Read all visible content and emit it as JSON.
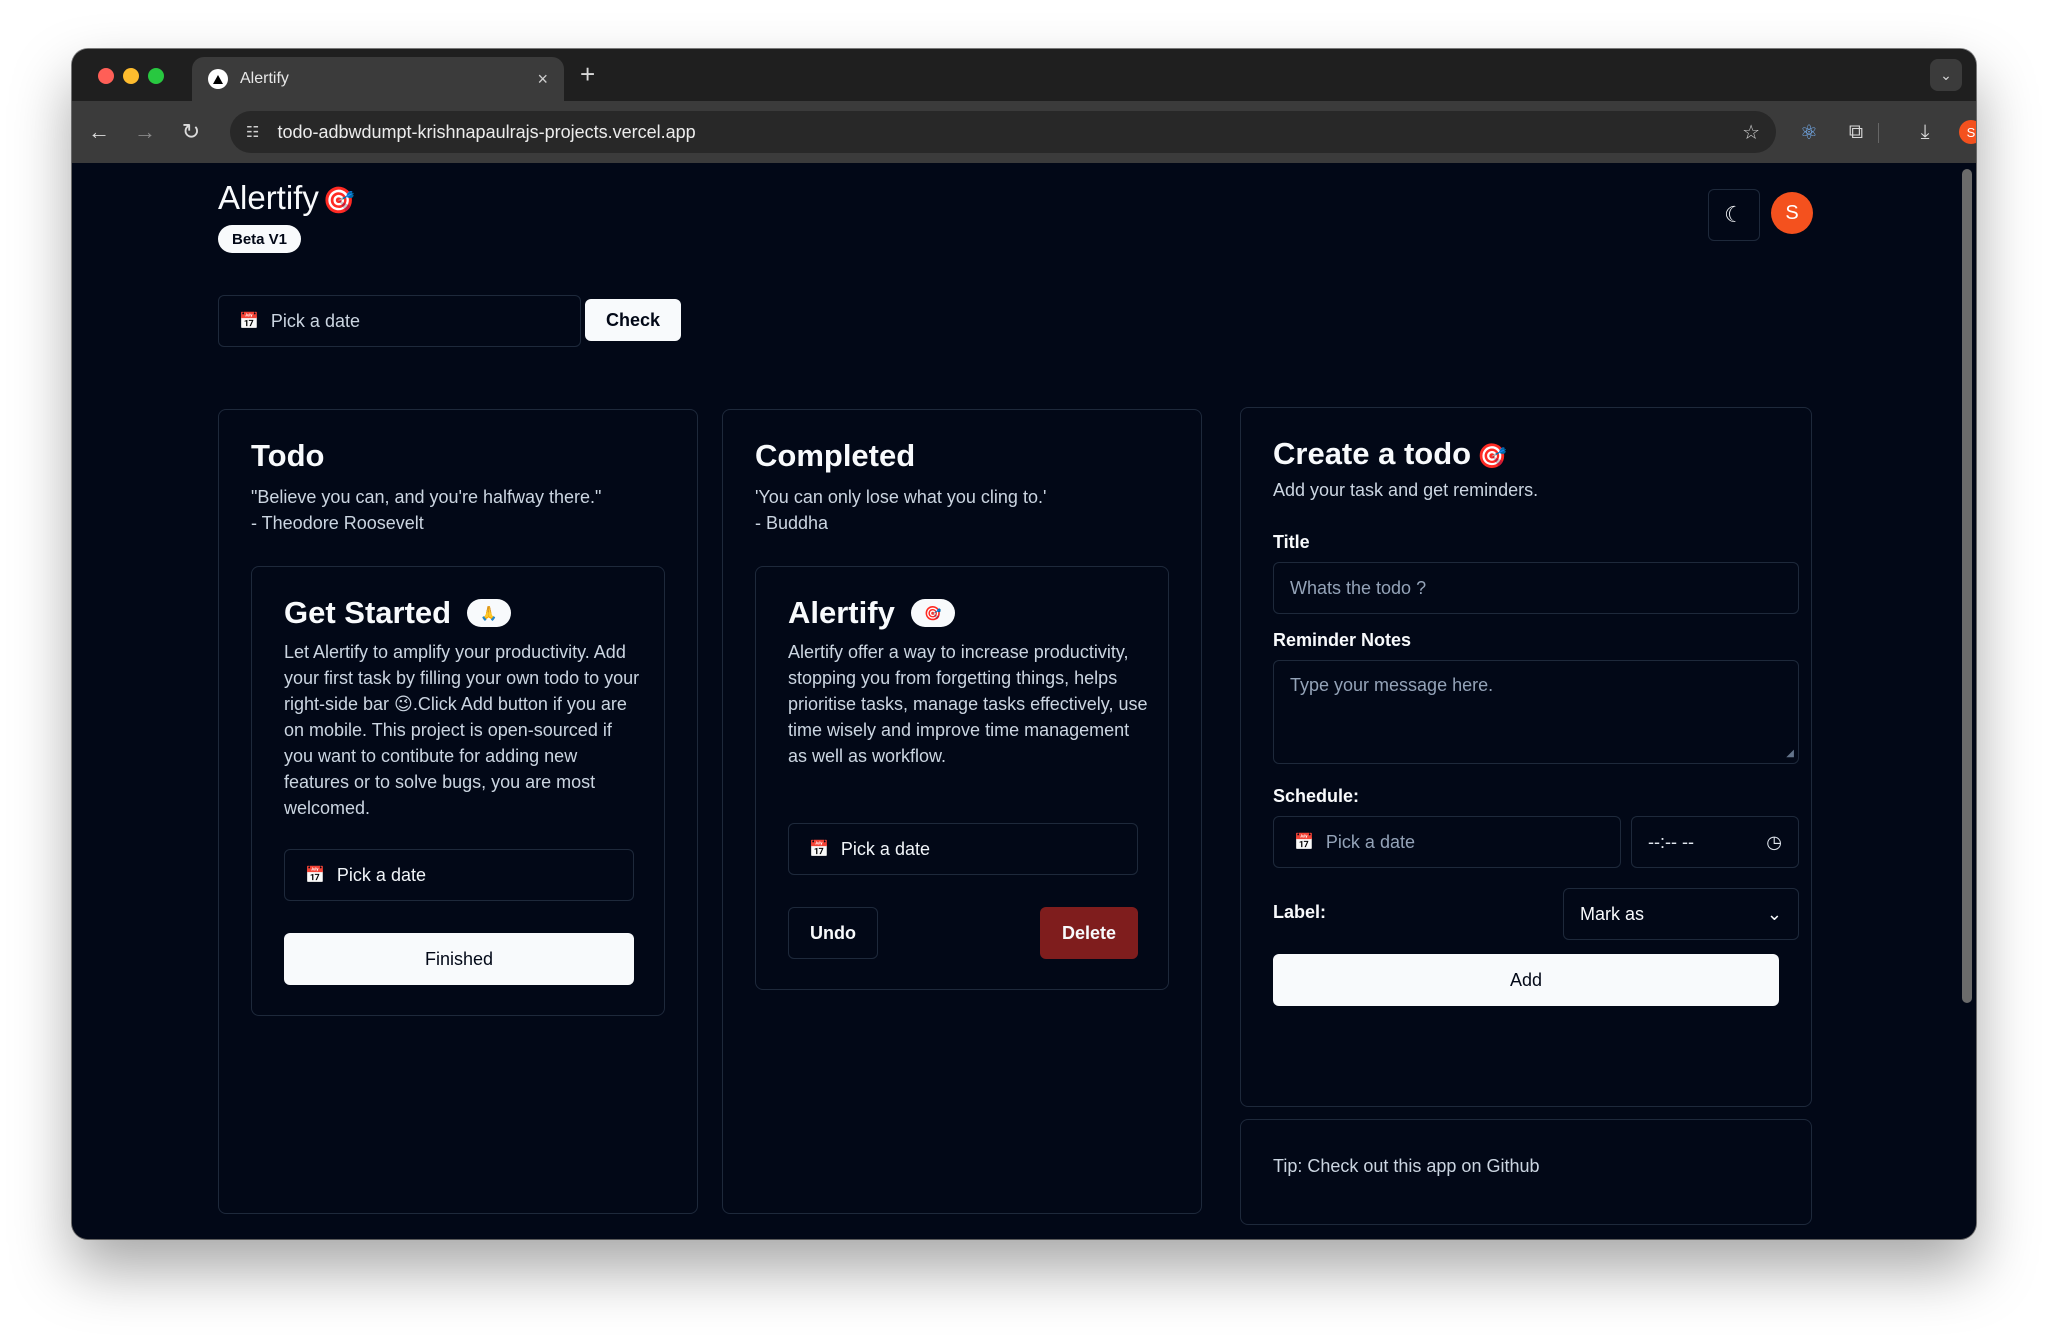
{
  "browser": {
    "tab_title": "Alertify",
    "tab_close": "×",
    "new_tab": "+",
    "url": "todo-adbwdumpt-krishnapaulrajs-projects.vercel.app",
    "avatar_letter": "S"
  },
  "header": {
    "brand": "Alertify",
    "brand_emoji": "🎯",
    "beta_label": "Beta V1",
    "avatar_letter": "S"
  },
  "filter": {
    "date_placeholder": "Pick a date",
    "check_label": "Check"
  },
  "todo": {
    "title": "Todo",
    "quote_line1": "\"Believe you can, and you're halfway there.\"",
    "quote_line2": "- Theodore Roosevelt",
    "card": {
      "title": "Get Started",
      "emoji": "🙏",
      "description": "Let Alertify to amplify your productivity. Add your first task by filling your own todo to your right-side bar 😉.Click Add button if you are on mobile. This project is open-sourced if you want to contibute for adding new features or to solve bugs, you are most welcomed.",
      "date_placeholder": "Pick a date",
      "finish_label": "Finished"
    }
  },
  "completed": {
    "title": "Completed",
    "quote_line1": "'You can only lose what you cling to.'",
    "quote_line2": "- Buddha",
    "card": {
      "title": "Alertify",
      "emoji": "🎯",
      "description": "Alertify offer a way to increase productivity, stopping you from forgetting things, helps prioritise tasks, manage tasks effectively, use time wisely and improve time management as well as workflow.",
      "date_placeholder": "Pick a date",
      "undo_label": "Undo",
      "delete_label": "Delete"
    }
  },
  "create": {
    "title": "Create a todo",
    "emoji": "🎯",
    "subtitle": "Add your task and get reminders.",
    "title_label": "Title",
    "title_placeholder": "Whats the todo ?",
    "notes_label": "Reminder Notes",
    "notes_placeholder": "Type your message here.",
    "schedule_label": "Schedule:",
    "schedule_date_placeholder": "Pick a date",
    "schedule_time": "--:-- --",
    "label_label": "Label:",
    "label_select": "Mark as",
    "add_label": "Add"
  },
  "tip": {
    "text": "Tip: Check out this app on Github"
  },
  "icons": {
    "calendar": "calendar-icon",
    "clock": "clock-icon",
    "chevron": "chevron-down-icon",
    "moon": "moon-icon"
  }
}
